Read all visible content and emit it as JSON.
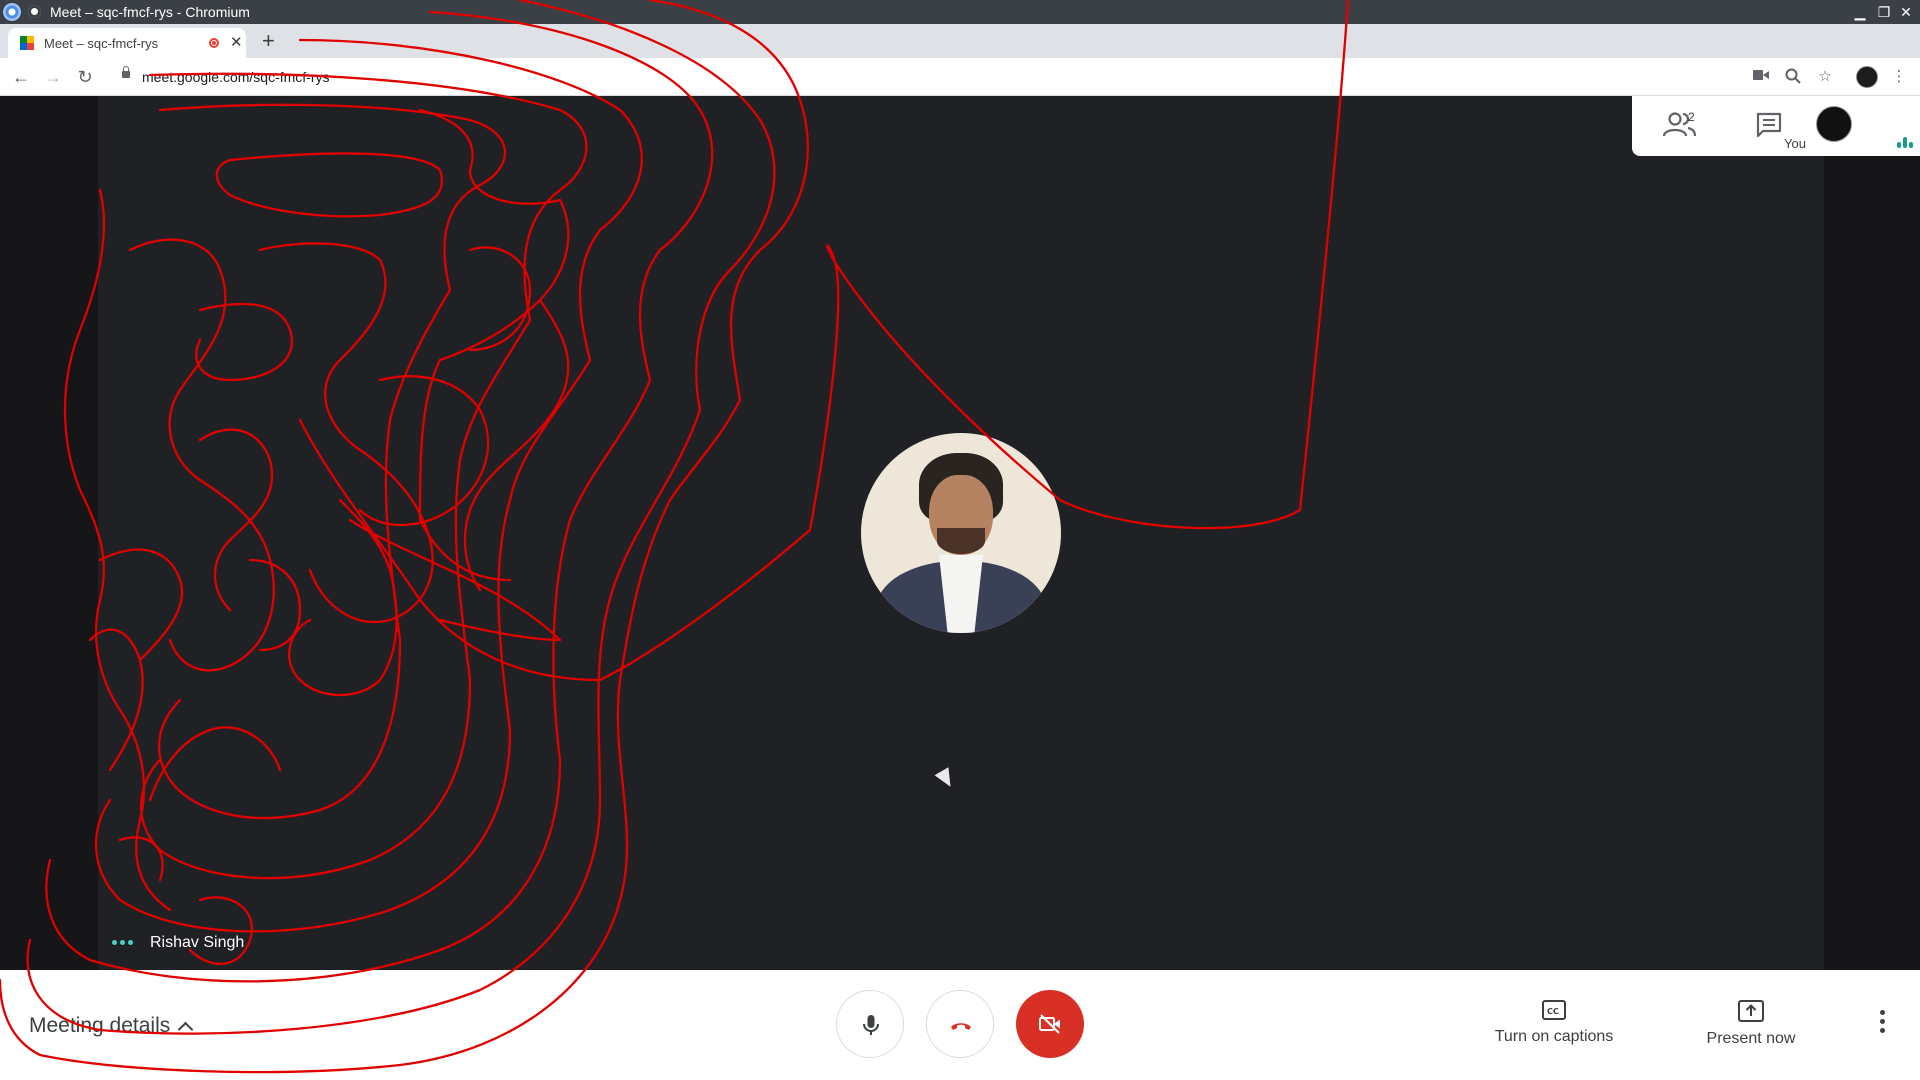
{
  "window": {
    "title": "Meet – sqc-fmcf-rys - Chromium"
  },
  "tab": {
    "title": "Meet – sqc-fmcf-rys"
  },
  "toolbar": {
    "url": "meet.google.com/sqc-fmcf-rys"
  },
  "meet": {
    "participant_count": "2",
    "self_label": "You",
    "speaker_name": "Rishav Singh"
  },
  "bottom": {
    "meeting_details": "Meeting details",
    "captions_label": "Turn on captions",
    "present_label": "Present now"
  },
  "colors": {
    "stage_bg": "#202124",
    "end_call_red": "#d93025",
    "annotation_red": "#e00000",
    "speaking_teal": "#4fd1c5"
  }
}
